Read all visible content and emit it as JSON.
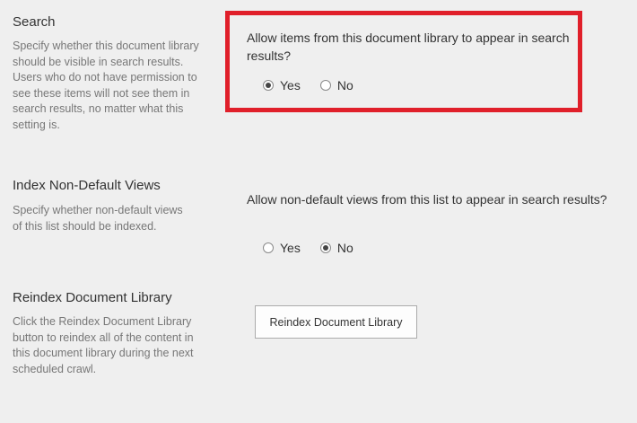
{
  "search": {
    "title": "Search",
    "description": "Specify whether this document library should be visible in search results. Users who do not have permission to see these items will not see them in search results, no matter what this setting is.",
    "question": "Allow items from this document library to appear in search results?",
    "options": [
      "Yes",
      "No"
    ],
    "selected": "Yes"
  },
  "index_views": {
    "title": "Index Non-Default Views",
    "description": "Specify whether non-default views of this list should be indexed.",
    "question": "Allow non-default views from this list to appear in search results?",
    "options": [
      "Yes",
      "No"
    ],
    "selected": "No"
  },
  "reindex": {
    "title": "Reindex Document Library",
    "description": "Click the Reindex Document Library button to reindex all of the content in this document library during the next scheduled crawl.",
    "button_label": "Reindex Document Library"
  },
  "colors": {
    "highlight": "#e01f2a",
    "background": "#efefef"
  }
}
